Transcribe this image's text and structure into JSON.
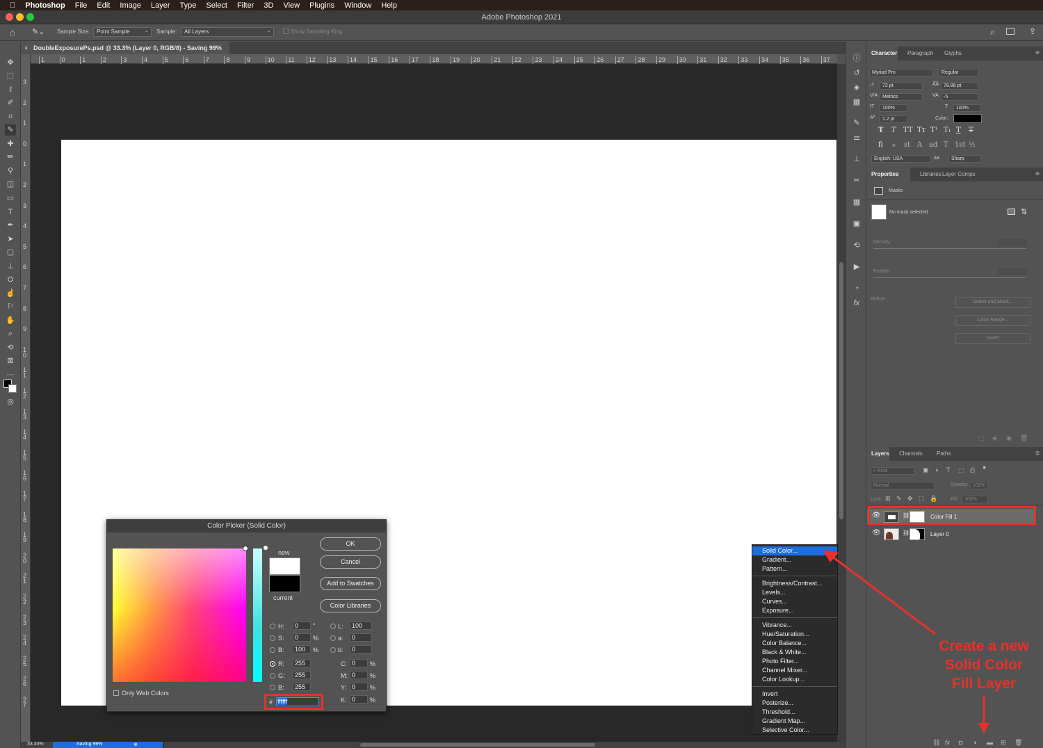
{
  "menubar": {
    "app": "Photoshop",
    "items": [
      "File",
      "Edit",
      "Image",
      "Layer",
      "Type",
      "Select",
      "Filter",
      "3D",
      "View",
      "Plugins",
      "Window",
      "Help"
    ]
  },
  "titlebar": {
    "title": "Adobe Photoshop 2021"
  },
  "options": {
    "sample_size_label": "Sample Size:",
    "sample_size_value": "Point Sample",
    "sample_label": "Sample:",
    "sample_value": "All Layers",
    "sampling_ring_label": "Show Sampling Ring"
  },
  "document_tab": {
    "close": "×",
    "title": "DoubleExposurePs.psd @ 33.3% (Layer 0, RGB/8) - Saving 99%"
  },
  "ruler_h": [
    "1",
    "0",
    "1",
    "2",
    "3",
    "4",
    "5",
    "6",
    "7",
    "8",
    "9",
    "10",
    "11",
    "12",
    "13",
    "14",
    "15",
    "16",
    "17",
    "18",
    "19",
    "20",
    "21",
    "22",
    "23",
    "24",
    "25",
    "26",
    "27",
    "28",
    "29",
    "30",
    "31",
    "32",
    "33",
    "34",
    "35",
    "36",
    "37"
  ],
  "ruler_v": [
    "3",
    "2",
    "1",
    "0",
    "1",
    "2",
    "3",
    "4",
    "5",
    "6",
    "7",
    "8",
    "9",
    "10",
    "11",
    "12",
    "13",
    "14",
    "15",
    "16",
    "17",
    "18",
    "19",
    "20",
    "21",
    "22",
    "23",
    "24",
    "25",
    "26",
    "27"
  ],
  "status": {
    "zoom": "33.33%",
    "saving": "Saving 99%"
  },
  "character_panel": {
    "tabs": [
      "Character",
      "Paragraph",
      "Glyphs"
    ],
    "font_family": "Myriad Pro",
    "font_style": "Regular",
    "font_size": "72 pt",
    "leading": "78.88 pt",
    "kerning": "Metrics",
    "tracking": "-5",
    "vertical_scale": "100%",
    "horizontal_scale": "100%",
    "baseline_shift": "1.2 pt",
    "color_label": "Color:",
    "language": "English: USA",
    "antialias_label": "aa",
    "antialias": "Sharp",
    "type_buttons": [
      "T",
      "T",
      "TT",
      "Tт",
      "T¹",
      "T₁",
      "T",
      "T"
    ],
    "opentype_buttons": [
      "fi",
      "ℴ",
      "st",
      "A",
      "ad",
      "T",
      "1st",
      "½"
    ]
  },
  "properties_panel": {
    "tabs": [
      "Properties",
      "Libraries",
      "Layer Comps"
    ],
    "section": "Masks",
    "mask_status": "No mask selected",
    "density_label": "Density:",
    "feather_label": "Feather:",
    "refine_label": "Refine:",
    "select_mask_btn": "Select and Mask...",
    "color_range_btn": "Color Range...",
    "invert_btn": "Invert"
  },
  "layers_panel": {
    "tabs": [
      "Layers",
      "Channels",
      "Paths"
    ],
    "filter_kind": "Kind",
    "blend_mode": "Normal",
    "opacity_label": "Opacity:",
    "opacity": "100%",
    "lock_label": "Lock:",
    "fill_label": "Fill:",
    "fill": "100%",
    "layers": [
      {
        "name": "Color Fill 1",
        "selected": true
      },
      {
        "name": "Layer 0",
        "selected": false
      }
    ]
  },
  "color_picker": {
    "title": "Color Picker (Solid Color)",
    "ok": "OK",
    "cancel": "Cancel",
    "add_swatches": "Add to Swatches",
    "color_libraries": "Color Libraries",
    "new_label": "new",
    "current_label": "current",
    "only_web": "Only Web Colors",
    "hsb": [
      {
        "label": "H:",
        "value": "0",
        "unit": "°"
      },
      {
        "label": "S:",
        "value": "0",
        "unit": "%"
      },
      {
        "label": "B:",
        "value": "100",
        "unit": "%"
      }
    ],
    "rgb": [
      {
        "label": "R:",
        "value": "255"
      },
      {
        "label": "G:",
        "value": "255"
      },
      {
        "label": "B:",
        "value": "255"
      }
    ],
    "lab": [
      {
        "label": "L:",
        "value": "100"
      },
      {
        "label": "a:",
        "value": "0"
      },
      {
        "label": "b:",
        "value": "0"
      }
    ],
    "cmyk": [
      {
        "label": "C:",
        "value": "0",
        "unit": "%"
      },
      {
        "label": "M:",
        "value": "0",
        "unit": "%"
      },
      {
        "label": "Y:",
        "value": "0",
        "unit": "%"
      },
      {
        "label": "K:",
        "value": "0",
        "unit": "%"
      }
    ],
    "hex_label": "#",
    "hex": "ffffff",
    "new_color": "#ffffff",
    "current_color": "#000000"
  },
  "fill_menu": {
    "group1": [
      "Solid Color...",
      "Gradient...",
      "Pattern..."
    ],
    "group2": [
      "Brightness/Contrast...",
      "Levels...",
      "Curves...",
      "Exposure..."
    ],
    "group3": [
      "Vibrance...",
      "Hue/Saturation...",
      "Color Balance...",
      "Black & White...",
      "Photo Filter...",
      "Channel Mixer...",
      "Color Lookup..."
    ],
    "group4": [
      "Invert",
      "Posterize...",
      "Threshold...",
      "Gradient Map...",
      "Selective Color..."
    ],
    "highlighted": "Solid Color..."
  },
  "annotation": {
    "lines": [
      "Create a new",
      "Solid Color",
      "Fill Layer"
    ],
    "color": "#e8312a"
  }
}
